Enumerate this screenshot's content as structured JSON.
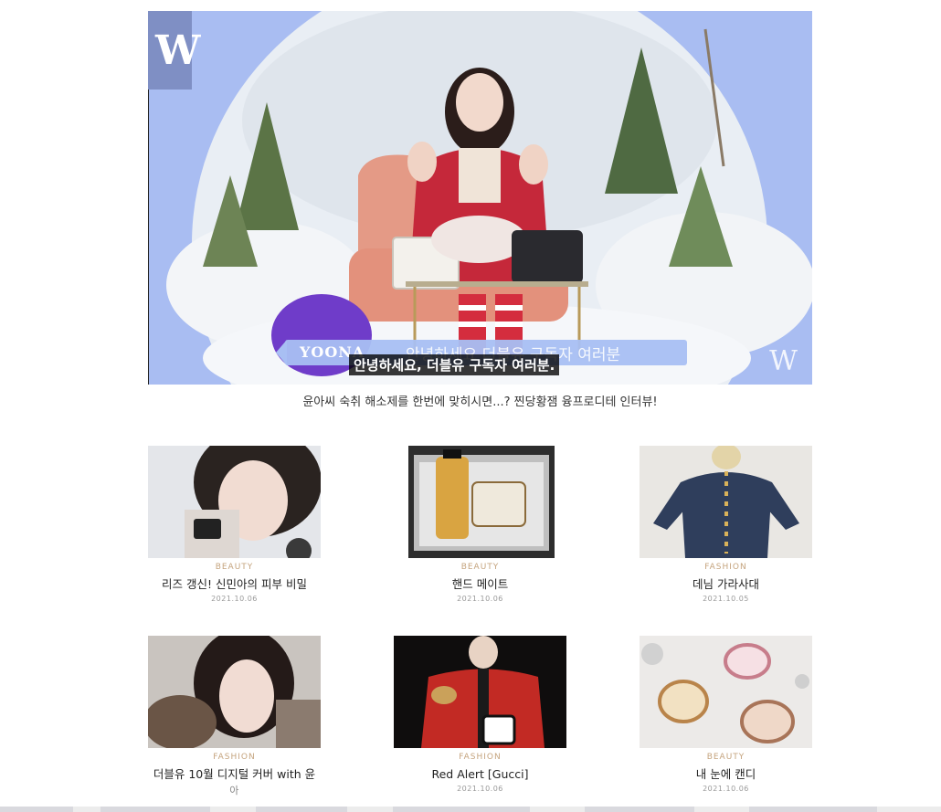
{
  "hero": {
    "logo_letter": "W",
    "name_tag": "YOONA",
    "ribbon_caption": "안녕하세요 더블유 구독자 여러분",
    "subtitle": "안녕하세요, 더블유 구독자 여러분.",
    "watermark": "W",
    "caption": "윤아씨 숙취 해소제를 한번에 맞히시면...? 찐당황잼 융프로디테 인터뷰!"
  },
  "articles": [
    {
      "category": "BEAUTY",
      "title": "리즈 갱신! 신민아의 피부 비밀",
      "date": "2021.10.06"
    },
    {
      "category": "BEAUTY",
      "title": "핸드 메이트",
      "date": "2021.10.06"
    },
    {
      "category": "FASHION",
      "title": "데님 가라사대",
      "date": "2021.10.05"
    },
    {
      "category": "FASHION",
      "title": "더블유 10월 디지털 커버 with 윤",
      "title_cont": "아",
      "date": ""
    },
    {
      "category": "FASHION",
      "title": "Red Alert [Gucci]",
      "date": "2021.10.06"
    },
    {
      "category": "BEAUTY",
      "title": "내 눈에 캔디",
      "date": "2021.10.06"
    }
  ],
  "colors": {
    "hero_bg": "#a9bdf2",
    "category_accent": "#c5a47e",
    "date_gray": "#9a9a9a"
  }
}
